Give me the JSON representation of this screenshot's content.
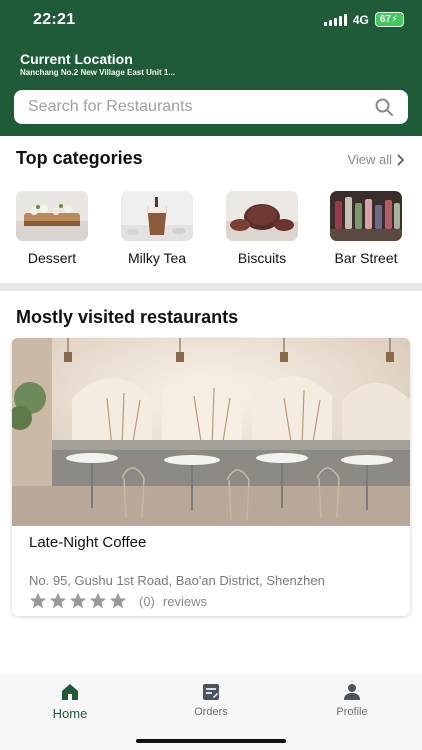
{
  "status_bar": {
    "time": "22:21",
    "network": "4G",
    "battery": "67"
  },
  "location": {
    "title": "Current Location",
    "address": "Nanchang No.2 New Village East Unit 1..."
  },
  "search": {
    "placeholder": "Search for Restaurants"
  },
  "categories_section": {
    "title": "Top categories",
    "view_all": "View all",
    "items": [
      {
        "label": "Dessert"
      },
      {
        "label": "Milky Tea"
      },
      {
        "label": "Biscuits"
      },
      {
        "label": "Bar Street"
      }
    ]
  },
  "restaurants_section": {
    "title": "Mostly visited restaurants",
    "items": [
      {
        "name": "Late-Night Coffee",
        "address": "No. 95, Gushu 1st Road, Bao'an District, Shenzhen",
        "rating_count": "(0)",
        "reviews_label": "reviews",
        "stars": 0,
        "max_stars": 5
      }
    ]
  },
  "bottom_nav": {
    "items": [
      {
        "label": "Home"
      },
      {
        "label": "Orders"
      },
      {
        "label": "Profile"
      }
    ]
  },
  "colors": {
    "brand": "#1f5b38",
    "battery": "#43c85c",
    "muted": "#8a8a8a"
  }
}
